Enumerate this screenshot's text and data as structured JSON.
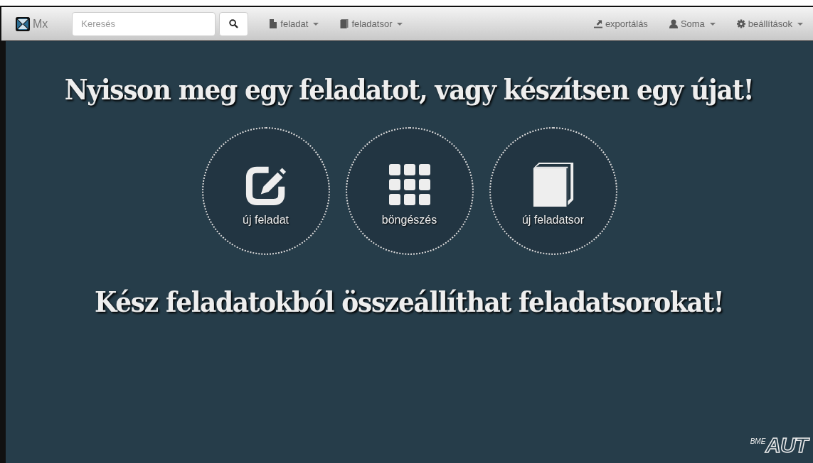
{
  "navbar": {
    "brand": "Mx",
    "search": {
      "placeholder": "Keresés"
    },
    "menus_left": [
      {
        "label": "feladat",
        "kind": "file",
        "dropdown": true
      },
      {
        "label": "feladatsor",
        "kind": "book",
        "dropdown": true
      }
    ],
    "menus_right": [
      {
        "label": "exportálás",
        "kind": "export",
        "dropdown": false
      },
      {
        "label": "Soma",
        "kind": "user",
        "dropdown": true
      },
      {
        "label": "beállítások",
        "kind": "gear",
        "dropdown": true
      }
    ]
  },
  "headline": "Nyisson meg egy feladatot, vagy készítsen egy újat!",
  "actions": [
    {
      "label": "új feladat",
      "kind": "edit"
    },
    {
      "label": "böngészés",
      "kind": "grid"
    },
    {
      "label": "új feladatsor",
      "kind": "book"
    }
  ],
  "subheadline": "Kész feladatokból összeállíthat feladatsorokat!",
  "logo": {
    "small": "BME",
    "large": "AUT"
  }
}
